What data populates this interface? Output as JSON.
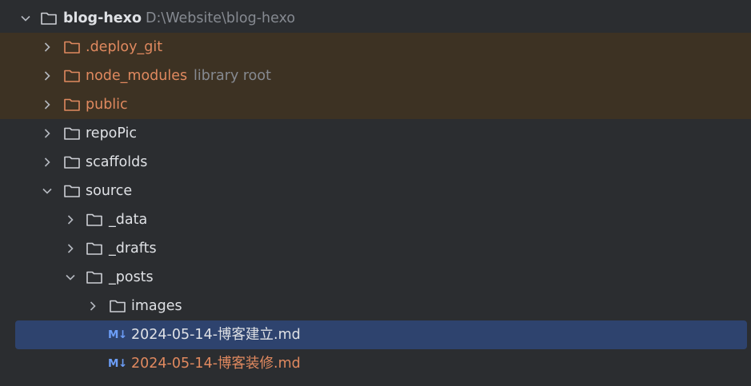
{
  "project": {
    "name": "blog-hexo",
    "path": "D:\\Website\\blog-hexo"
  },
  "items": [
    {
      "label": ".deploy_git"
    },
    {
      "label": "node_modules",
      "hint": "library root"
    },
    {
      "label": "public"
    },
    {
      "label": "repoPic"
    },
    {
      "label": "scaffolds"
    },
    {
      "label": "source"
    },
    {
      "label": "_data"
    },
    {
      "label": "_drafts"
    },
    {
      "label": "_posts"
    },
    {
      "label": "images"
    },
    {
      "label": "2024-05-14-博客建立.md",
      "icon": "M↓"
    },
    {
      "label": "2024-05-14-博客装修.md",
      "icon": "M↓"
    }
  ],
  "colors": {
    "background": "#2b2d30",
    "excluded_row": "#3d3223",
    "selected_row": "#2e436e",
    "excluded_text": "#e0895f",
    "markdown_icon": "#6c9ef8",
    "hint_text": "#868a91"
  },
  "icons": {
    "expanded": "chevron-down-icon",
    "collapsed": "chevron-right-icon",
    "folder": "folder-icon",
    "markdown": "markdown-file-icon"
  }
}
